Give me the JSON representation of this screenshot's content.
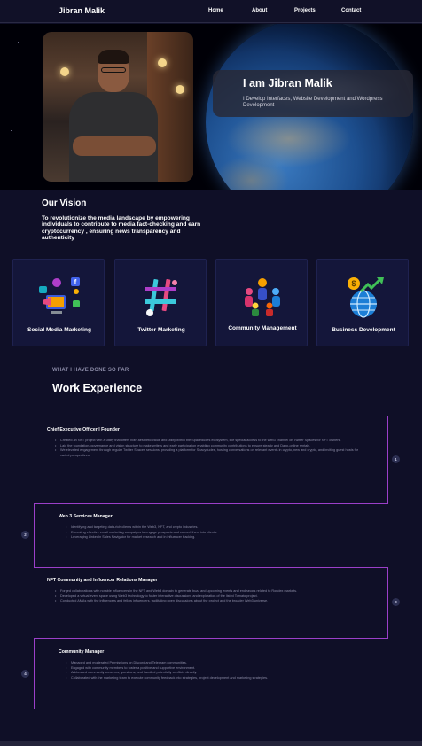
{
  "nav": {
    "brand": "Jibran Malik",
    "links": [
      "Home",
      "About",
      "Projects",
      "Contact"
    ]
  },
  "hero": {
    "name": "I am Jibran Malik",
    "tagline": "I Develop Interfaces, Website Development and Wordpress Development"
  },
  "vision": {
    "title": "Our Vision",
    "text": "To revolutionize the media landscape by empowering individuals to contribute to media fact-checking and earn cryptocurrency , ensuring news transparency and authenticity"
  },
  "services": [
    {
      "label": "Social Media Marketing",
      "icon": "social-media-marketing-icon"
    },
    {
      "label": "Twitter Marketing",
      "icon": "twitter-marketing-icon"
    },
    {
      "label": "Community Management",
      "icon": "community-management-icon"
    },
    {
      "label": "Business Development",
      "icon": "business-development-icon"
    }
  ],
  "experience": {
    "eyebrow": "WHAT I HAVE DONE SO FAR",
    "title": "Work Experience",
    "items": [
      {
        "index": "1",
        "role": "Chief Executive Officer | Founder",
        "bullets": [
          "Created an NFT project with a utility that offers both aesthetic value and utility within the Spacedudes ecosystem, like special access to the web3 channel on Twitter Spaces for NFT owners.",
          "Laid the foundation, governance and vision structure to make writers and early participation enabling community contributions to ensure steady and Dapp-online rentals.",
          "We elevated engagement through regular Twitter Spaces sessions, providing a platform for Spacydudes, hosting conversations on relevant events in crypto, new and crypto, and inviting guest hosts for varied perspectives."
        ]
      },
      {
        "index": "2",
        "role": "Web 3 Services Manager",
        "bullets": [
          "Identifying and targeting data-rich clients within the Web3, NFT, and crypto industries.",
          "Executing effective email marketing campaigns to engage prospects and convert them into clients.",
          "Leveraging LinkedIn Sales Navigator for market research and in influencer tracking."
        ]
      },
      {
        "index": "3",
        "role": "NFT Community and Influencer Relations Manager",
        "bullets": [
          "Forged collaborations with notable influencers in the NFT and Web3 domain to generate buzz and upcoming events and endeavors related to Rondex markets.",
          "Developed a virtual event space using Web3 technology to foster interactive discussions and exploration of the listed Tomato project.",
          "Conducted AMAs with the influencers and fellow influencers, facilitating open discussions about the project and the broader Web3 universe."
        ]
      },
      {
        "index": "4",
        "role": "Community Manager",
        "bullets": [
          "Managed and moderated Permissions on Discord and Telegram communities.",
          "Engaged with community members to foster a positive and supportive environment.",
          "Addressed community concerns, questions, and handled potentially conflicts directly.",
          "Collaborated with the marketing team to execute community feedback into strategies, project development and marketing strategies."
        ]
      }
    ]
  },
  "colors": {
    "background": "#0f0f27",
    "card": "#14163a",
    "timeline": "#9b3fc9",
    "muted_text": "#8c8ca6"
  }
}
